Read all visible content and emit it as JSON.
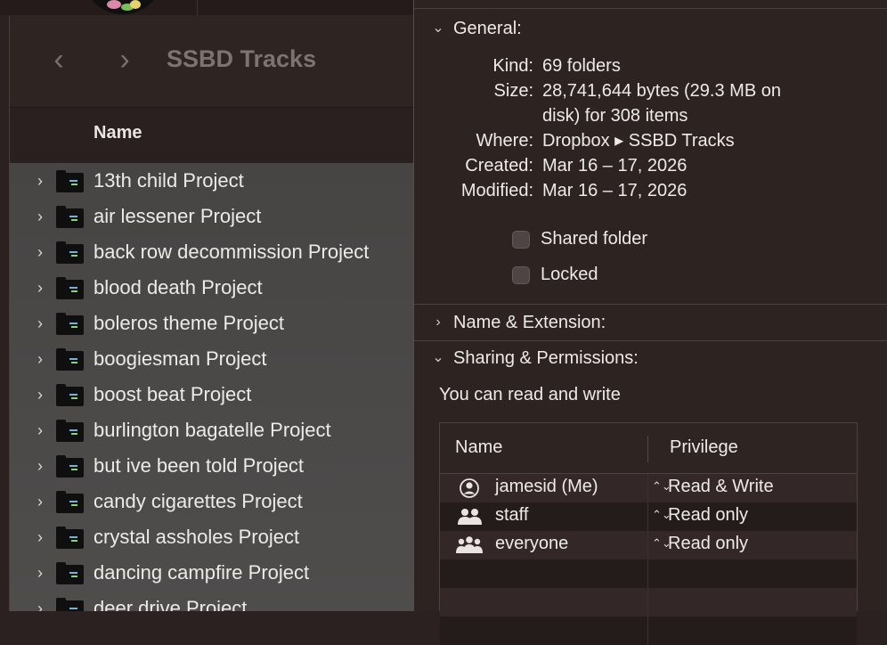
{
  "finder": {
    "title": "SSBD Tracks",
    "back_icon": "‹",
    "forward_icon": "›",
    "column_name": "Name",
    "disclosure_icon": "›",
    "items": [
      "13th child Project",
      "air lessener Project",
      "back row decommission Project",
      "blood death Project",
      "boleros theme Project",
      "boogiesman Project",
      "boost beat Project",
      "burlington bagatelle Project",
      "but ive been told Project",
      "candy cigarettes Project",
      "crystal assholes Project",
      "dancing campfire Project",
      "deer drive Project"
    ]
  },
  "info": {
    "general": {
      "title": "General:",
      "chevron": "⌄",
      "kind_label": "Kind:",
      "kind_value": "69 folders",
      "size_label": "Size:",
      "size_line1": "28,741,644 bytes (29.3 MB on",
      "size_line2": "disk) for 308 items",
      "where_label": "Where:",
      "where_value": "Dropbox ▸ SSBD Tracks",
      "created_label": "Created:",
      "created_value": "Mar 16 – 17, 2026",
      "modified_label": "Modified:",
      "modified_value": "Mar 16 – 17, 2026",
      "shared_folder_label": "Shared folder",
      "locked_label": "Locked"
    },
    "name_extension": {
      "title": "Name & Extension:",
      "chevron": "›"
    },
    "sharing": {
      "title": "Sharing & Permissions:",
      "chevron": "⌄",
      "note": "You can read and write",
      "col_name": "Name",
      "col_privilege": "Privilege",
      "stepper_icon": "⌃⌄",
      "rows": [
        {
          "name": "jamesid (Me)",
          "privilege": "Read & Write",
          "icon": "user-circle-icon"
        },
        {
          "name": "staff",
          "privilege": "Read only",
          "icon": "group-icon"
        },
        {
          "name": "everyone",
          "privilege": "Read only",
          "icon": "everyone-icon"
        }
      ]
    }
  }
}
